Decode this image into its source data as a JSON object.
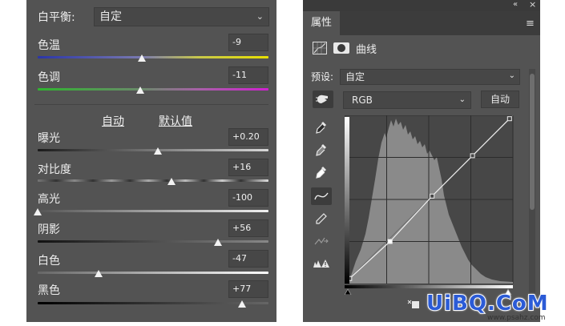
{
  "camera_raw": {
    "white_balance": {
      "label": "白平衡:",
      "value": "自定"
    },
    "temperature": {
      "label": "色温",
      "value": "-9",
      "position": 0.45
    },
    "tint": {
      "label": "色调",
      "value": "-11",
      "position": 0.445
    },
    "auto_link": "自动",
    "default_link": "默认值",
    "exposure": {
      "label": "曝光",
      "value": "+0.20",
      "position": 0.52
    },
    "contrast": {
      "label": "对比度",
      "value": "+16",
      "position": 0.58
    },
    "highlights": {
      "label": "高光",
      "value": "-100",
      "position": 0.0
    },
    "shadows": {
      "label": "阴影",
      "value": "+56",
      "position": 0.78
    },
    "whites": {
      "label": "白色",
      "value": "-47",
      "position": 0.265
    },
    "blacks": {
      "label": "黑色",
      "value": "+77",
      "position": 0.885
    }
  },
  "properties": {
    "tab": "属性",
    "panel_title": "曲线",
    "preset_label": "预设:",
    "preset_value": "自定",
    "channel": "RGB",
    "auto_button": "自动",
    "curve_points": [
      [
        0.03,
        0.03
      ],
      [
        0.27,
        0.25
      ],
      [
        0.52,
        0.52
      ],
      [
        0.76,
        0.76
      ],
      [
        0.98,
        0.98
      ]
    ]
  },
  "watermark": {
    "brand": "UiBQ.CoM",
    "url": "www.psahz.com"
  },
  "colors": {
    "panel": "#535353",
    "field": "#474747",
    "accent_blue": "#2b5bd6"
  }
}
